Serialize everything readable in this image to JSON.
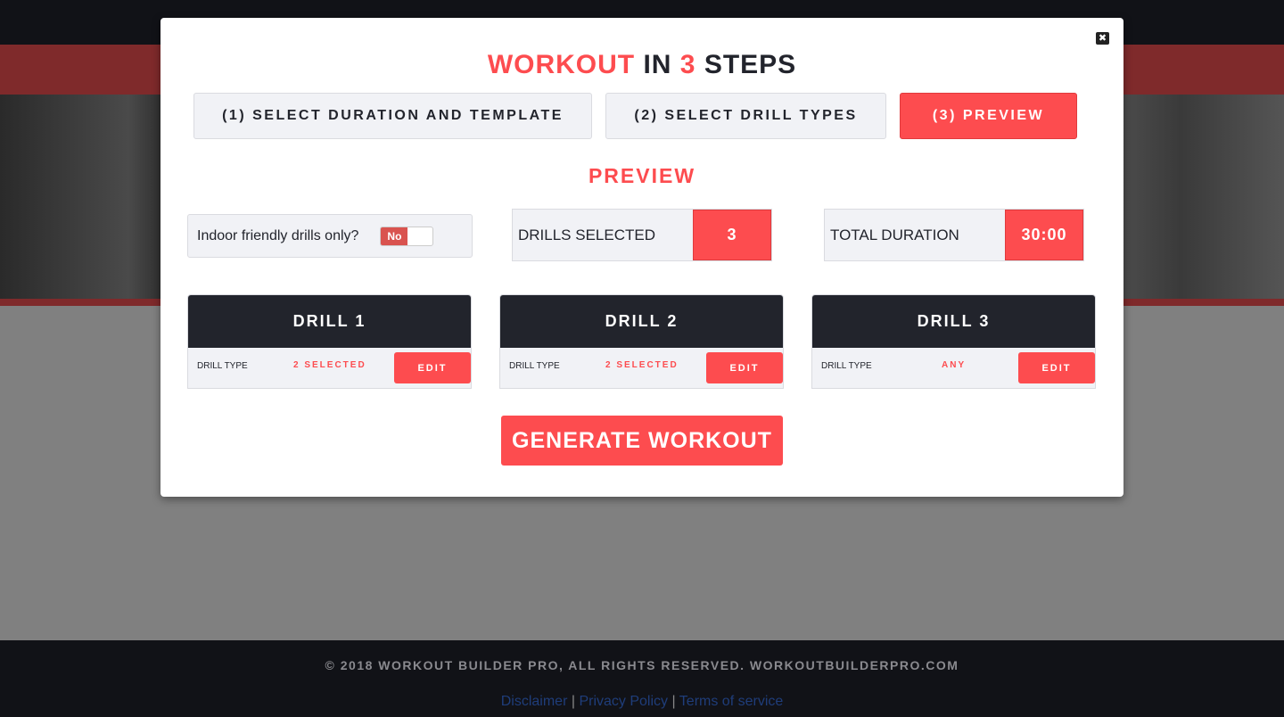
{
  "modal": {
    "title": {
      "part1": "WORKOUT",
      "part2": " IN ",
      "part3": "3",
      "part4": " STEPS"
    },
    "close_icon": "close-icon",
    "steps": [
      {
        "label": "(1) SELECT DURATION AND TEMPLATE",
        "active": false
      },
      {
        "label": "(2) SELECT DRILL TYPES",
        "active": false
      },
      {
        "label": "(3) PREVIEW",
        "active": true
      }
    ],
    "section_title": "PREVIEW",
    "indoor": {
      "label": "Indoor friendly drills only?",
      "toggle": "No"
    },
    "drills_selected": {
      "label": "DRILLS SELECTED",
      "value": "3"
    },
    "total_duration": {
      "label": "TOTAL DURATION",
      "value": "30:00"
    },
    "drills": [
      {
        "title": "DRILL 1",
        "type_label": "DRILL TYPE",
        "type_value": "2 SELECTED",
        "edit": "EDIT"
      },
      {
        "title": "DRILL 2",
        "type_label": "DRILL TYPE",
        "type_value": "2 SELECTED",
        "edit": "EDIT"
      },
      {
        "title": "DRILL 3",
        "type_label": "DRILL TYPE",
        "type_value": "ANY",
        "edit": "EDIT"
      }
    ],
    "generate": "GENERATE WORKOUT"
  },
  "footer": {
    "copyright": "© 2018 WORKOUT BUILDER PRO, ALL RIGHTS RESERVED. WORKOUTBUILDERPRO.COM",
    "links": [
      "Disclaimer",
      "Privacy Policy",
      "Terms of service"
    ],
    "separator": "|"
  },
  "colors": {
    "accent": "#fd4c4f",
    "dark": "#22242c",
    "panel": "#f1f2f6"
  }
}
